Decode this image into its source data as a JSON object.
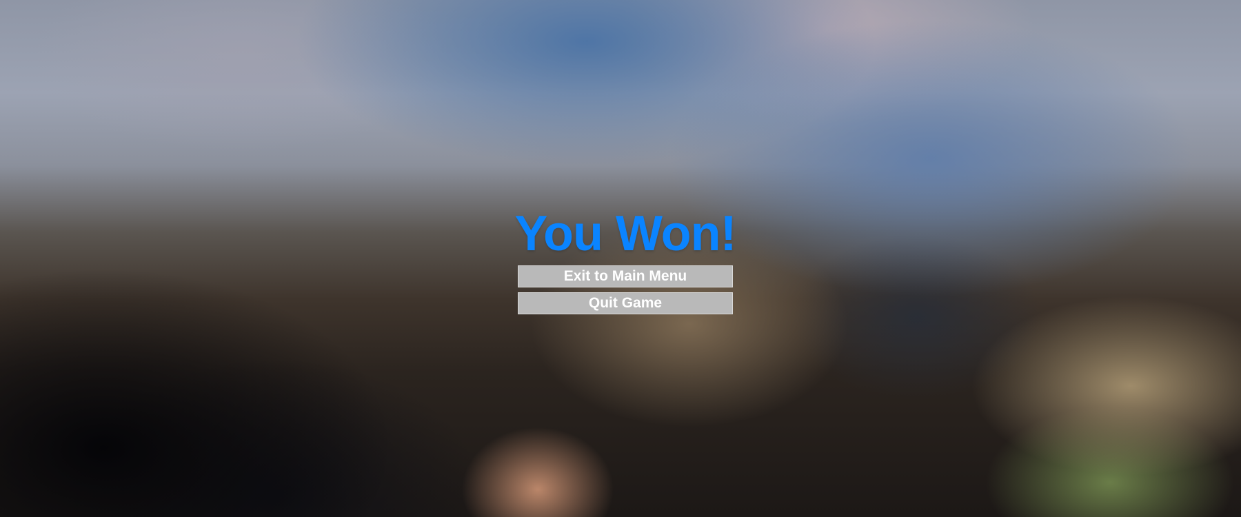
{
  "screen": {
    "title": "You Won!",
    "title_color": "#0a84ff"
  },
  "menu": {
    "exit_label": "Exit to Main Menu",
    "quit_label": "Quit Game",
    "button_color": "#b9b9b9"
  }
}
